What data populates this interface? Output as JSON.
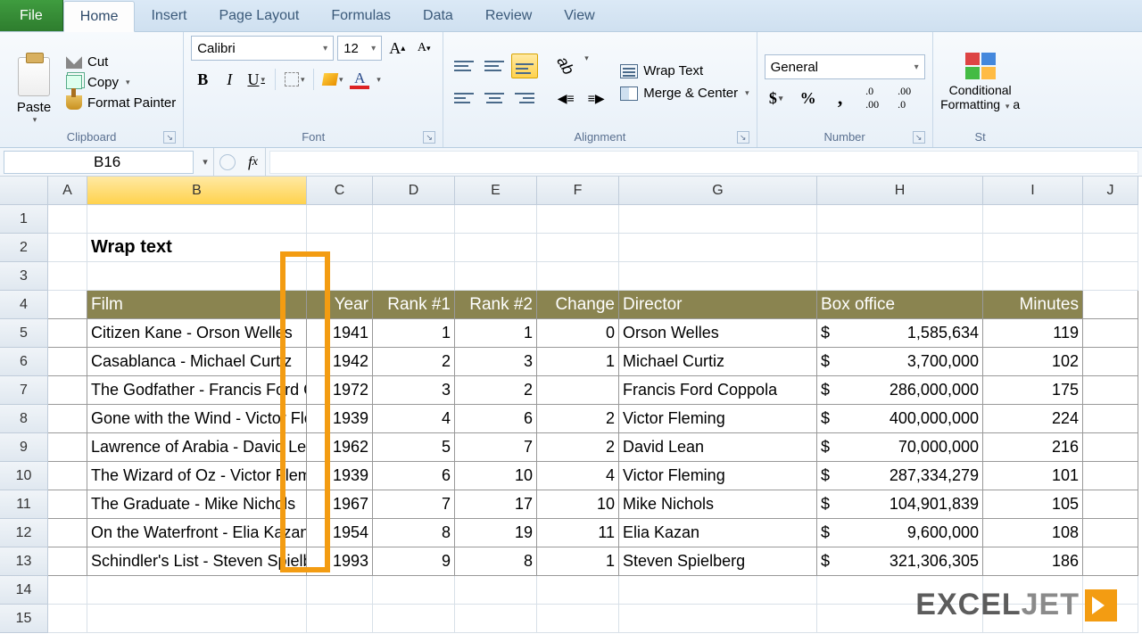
{
  "tabs": {
    "file": "File",
    "home": "Home",
    "insert": "Insert",
    "pagelayout": "Page Layout",
    "formulas": "Formulas",
    "data": "Data",
    "review": "Review",
    "view": "View"
  },
  "clipboard": {
    "paste": "Paste",
    "cut": "Cut",
    "copy": "Copy",
    "formatpainter": "Format Painter",
    "label": "Clipboard"
  },
  "font": {
    "name": "Calibri",
    "size": "12",
    "label": "Font"
  },
  "alignment": {
    "wrap": "Wrap Text",
    "merge": "Merge & Center",
    "label": "Alignment"
  },
  "number": {
    "format": "General",
    "label": "Number"
  },
  "styles": {
    "cond": "Conditional",
    "cond2": "Formatting",
    "label": "St"
  },
  "namebox": "B16",
  "sheet": {
    "title": "Wrap text",
    "cols": [
      "A",
      "B",
      "C",
      "D",
      "E",
      "F",
      "G",
      "H",
      "I",
      "J"
    ],
    "headers": {
      "film": "Film",
      "year": "Year",
      "rank1": "Rank #1",
      "rank2": "Rank #2",
      "change": "Change",
      "director": "Director",
      "box": "Box office",
      "min": "Minutes"
    },
    "rows": [
      {
        "n": "5",
        "film": "Citizen Kane - Orson Welles",
        "year": "1941",
        "r1": "1",
        "r2": "1",
        "ch": "0",
        "dir": "Orson Welles",
        "box": "1,585,634",
        "min": "119"
      },
      {
        "n": "6",
        "film": "Casablanca - Michael Curtiz",
        "year": "1942",
        "r1": "2",
        "r2": "3",
        "ch": "1",
        "dir": "Michael Curtiz",
        "box": "3,700,000",
        "min": "102"
      },
      {
        "n": "7",
        "film": "The Godfather - Francis Ford Coppola",
        "year": "1972",
        "r1": "3",
        "r2": "2",
        "ch": "",
        "dir": "Francis Ford Coppola",
        "box": "286,000,000",
        "min": "175"
      },
      {
        "n": "8",
        "film": "Gone with the Wind - Victor Fleming",
        "year": "1939",
        "r1": "4",
        "r2": "6",
        "ch": "2",
        "dir": "Victor Fleming",
        "box": "400,000,000",
        "min": "224"
      },
      {
        "n": "9",
        "film": "Lawrence of Arabia - David Lean",
        "year": "1962",
        "r1": "5",
        "r2": "7",
        "ch": "2",
        "dir": "David Lean",
        "box": "70,000,000",
        "min": "216"
      },
      {
        "n": "10",
        "film": "The Wizard of Oz - Victor Fleming",
        "year": "1939",
        "r1": "6",
        "r2": "10",
        "ch": "4",
        "dir": "Victor Fleming",
        "box": "287,334,279",
        "min": "101"
      },
      {
        "n": "11",
        "film": "The Graduate - Mike Nichols",
        "year": "1967",
        "r1": "7",
        "r2": "17",
        "ch": "10",
        "dir": "Mike Nichols",
        "box": "104,901,839",
        "min": "105"
      },
      {
        "n": "12",
        "film": "On the Waterfront - Elia Kazan",
        "year": "1954",
        "r1": "8",
        "r2": "19",
        "ch": "11",
        "dir": "Elia Kazan",
        "box": "9,600,000",
        "min": "108"
      },
      {
        "n": "13",
        "film": "Schindler's List - Steven Spielberg",
        "year": "1993",
        "r1": "9",
        "r2": "8",
        "ch": "1",
        "dir": "Steven Spielberg",
        "box": "321,306,305",
        "min": "186"
      }
    ]
  },
  "logo": {
    "a": "EXCEL",
    "b": "JET"
  }
}
